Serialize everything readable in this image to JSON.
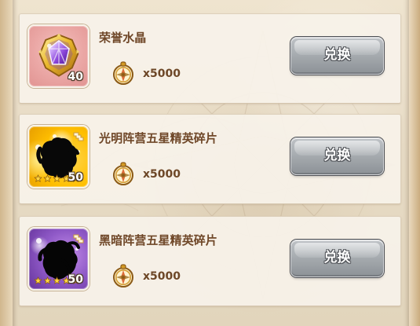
{
  "colors": {
    "panel_bg": "#f7f2ea",
    "title_text": "#6f4728",
    "price_text": "#6d4727",
    "button_gray": "#a8adb1",
    "button_outline": "#4d4f54",
    "crystal_bg": "#eba8a6",
    "light_bg": "#ffbf00",
    "dark_bg": "#8f59c7"
  },
  "items": [
    {
      "title": "荣誉水晶",
      "icon_type": "purple-crystal-icon",
      "quantity": "40",
      "price": "x5000",
      "button_label": "兑换"
    },
    {
      "title": "光明阵营五星精英碎片",
      "icon_type": "light-faction-hero-silhouette-icon",
      "quantity": "50",
      "stars": 5,
      "price": "x5000",
      "button_label": "兑换"
    },
    {
      "title": "黑暗阵营五星精英碎片",
      "icon_type": "dark-faction-hero-silhouette-icon",
      "quantity": "50",
      "stars": 5,
      "price": "x5000",
      "button_label": "兑换"
    }
  ]
}
